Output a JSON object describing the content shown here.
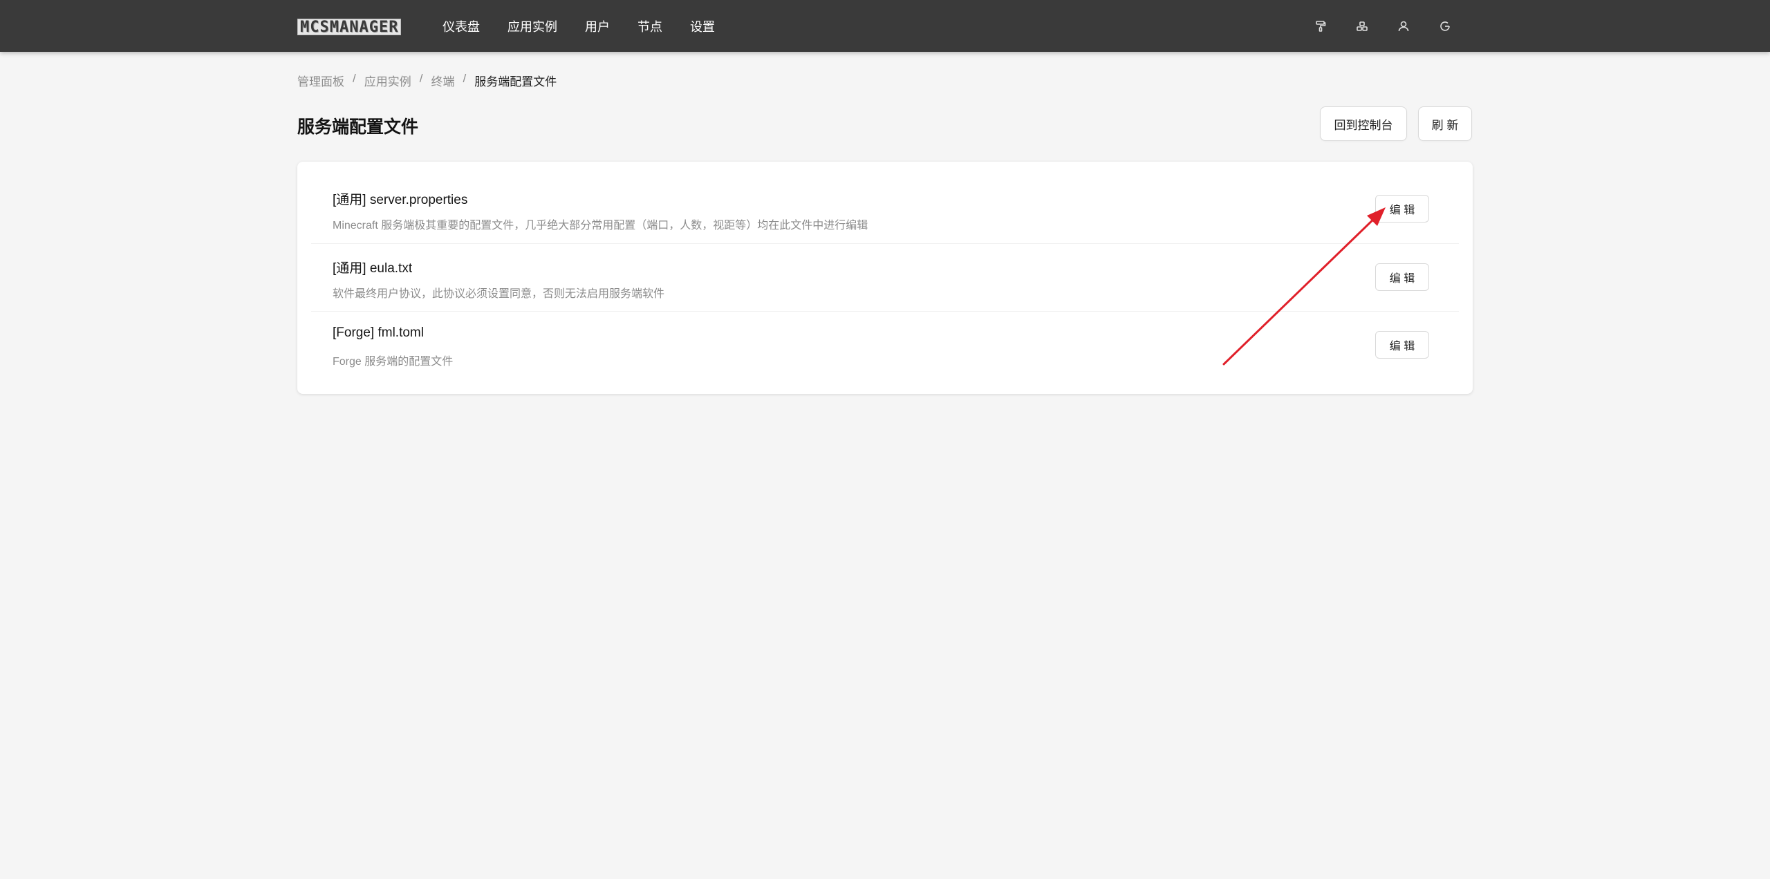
{
  "app": {
    "logo_text": "MCSMANAGER"
  },
  "nav": {
    "items": [
      "仪表盘",
      "应用实例",
      "用户",
      "节点",
      "设置"
    ]
  },
  "tools": {
    "icons": [
      "paint-roller-icon",
      "grid-icon",
      "user-icon",
      "logout-icon"
    ]
  },
  "breadcrumb": {
    "items": [
      "管理面板",
      "应用实例",
      "终端",
      "服务端配置文件"
    ],
    "separator": "/"
  },
  "page": {
    "title": "服务端配置文件",
    "console_button": "回到控制台",
    "refresh_button": "刷 新"
  },
  "files": [
    {
      "title": "[通用] server.properties",
      "description": "Minecraft 服务端极其重要的配置文件，几乎绝大部分常用配置（端口，人数，视距等）均在此文件中进行编辑",
      "edit_label": "编 辑"
    },
    {
      "title": "[通用] eula.txt",
      "description": "软件最终用户协议，此协议必须设置同意，否则无法启用服务端软件",
      "edit_label": "编 辑"
    },
    {
      "title": "[Forge] fml.toml",
      "description": "Forge 服务端的配置文件",
      "edit_label": "编 辑"
    }
  ],
  "colors": {
    "topbar": "#3a3a3a",
    "background": "#f5f5f5",
    "annotation_arrow": "#e0202a"
  }
}
